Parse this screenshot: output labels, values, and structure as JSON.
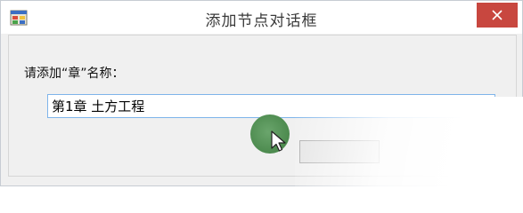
{
  "window": {
    "title": "添加节点对话框",
    "app_icon": "windows-form-icon",
    "close_icon": "close-icon",
    "close_color": "#c8473f"
  },
  "dialog": {
    "prompt_label": "请添加“章”名称：",
    "name_input_value": "第1章 土方工程",
    "ok_button_label": ""
  },
  "overlay": {
    "cursor_highlight_color": "#4c8a4e",
    "pointer_icon": "mouse-pointer-icon"
  }
}
